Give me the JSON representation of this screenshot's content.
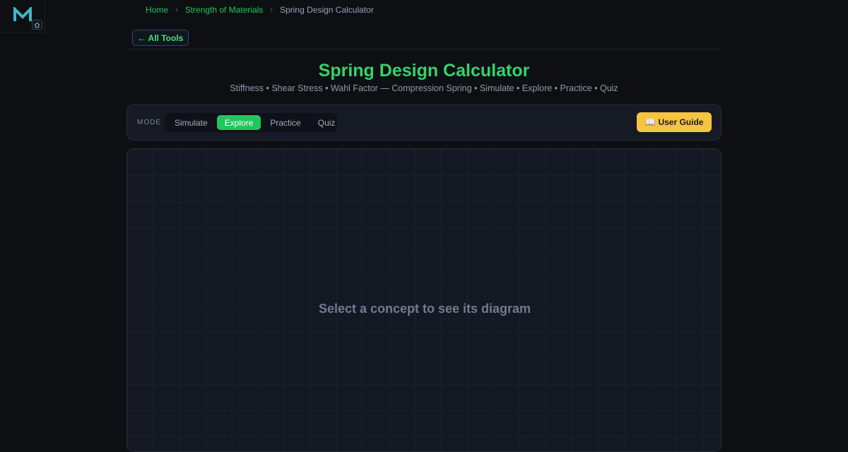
{
  "logo": {
    "icon": "m-logo-icon",
    "home_icon": "home-icon"
  },
  "breadcrumb": {
    "items": [
      "Home",
      "Strength of Materials",
      "Spring Design Calculator"
    ],
    "separator": "›"
  },
  "back_button": {
    "label": "← All Tools"
  },
  "header": {
    "title": "Spring Design Calculator",
    "subtitle": "Stiffness • Shear Stress • Wahl Factor — Compression Spring • Simulate • Explore • Practice • Quiz"
  },
  "mode_bar": {
    "label": "MODE",
    "tabs": [
      {
        "label": "Simulate",
        "active": false
      },
      {
        "label": "Explore",
        "active": true
      },
      {
        "label": "Practice",
        "active": false
      },
      {
        "label": "Quiz",
        "active": false
      }
    ],
    "guide_button": {
      "icon": "📖",
      "label": "User Guide"
    }
  },
  "canvas": {
    "placeholder": "Select a concept to see its diagram"
  },
  "colors": {
    "accent_green": "#22c55e",
    "title_green": "#34d36a",
    "guide_yellow": "#f5c542",
    "background": "#0d0f13"
  }
}
